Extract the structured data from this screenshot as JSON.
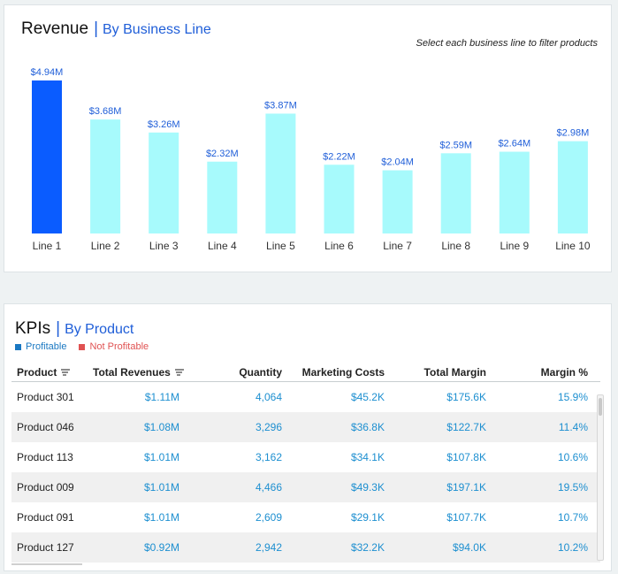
{
  "revenue": {
    "title": "Revenue",
    "separator": "|",
    "subtitle": "By Business Line",
    "hint": "Select each business line to filter products"
  },
  "chart_data": {
    "type": "bar",
    "categories": [
      "Line 1",
      "Line 2",
      "Line 3",
      "Line 4",
      "Line 5",
      "Line 6",
      "Line 7",
      "Line 8",
      "Line 9",
      "Line 10"
    ],
    "values": [
      4.94,
      3.68,
      3.26,
      2.32,
      3.87,
      2.22,
      2.04,
      2.59,
      2.64,
      2.98
    ],
    "data_labels": [
      "$4.94M",
      "$3.68M",
      "$3.26M",
      "$2.32M",
      "$3.87M",
      "$2.22M",
      "$2.04M",
      "$2.59M",
      "$2.64M",
      "$2.98M"
    ],
    "unit": "$M",
    "ylim": [
      0,
      4.94
    ],
    "selected_index": 0,
    "colors": {
      "selected": "#0a5cff",
      "default": "#a7fafc",
      "label": "#1f5ed8"
    },
    "grid": false
  },
  "kpis": {
    "title": "KPIs",
    "separator": "|",
    "subtitle": "By Product",
    "legend": [
      {
        "label": "Profitable",
        "color": "#1a78c2"
      },
      {
        "label": "Not Profitable",
        "color": "#e05252"
      }
    ],
    "columns": [
      "Product",
      "Total Revenues",
      "Quantity",
      "Marketing Costs",
      "Total Margin",
      "Margin %"
    ],
    "rows": [
      [
        "Product 301",
        "$1.11M",
        "4,064",
        "$45.2K",
        "$175.6K",
        "15.9%"
      ],
      [
        "Product 046",
        "$1.08M",
        "3,296",
        "$36.8K",
        "$122.7K",
        "11.4%"
      ],
      [
        "Product 113",
        "$1.01M",
        "3,162",
        "$34.1K",
        "$107.8K",
        "10.6%"
      ],
      [
        "Product 009",
        "$1.01M",
        "4,466",
        "$49.3K",
        "$197.1K",
        "19.5%"
      ],
      [
        "Product 091",
        "$1.01M",
        "2,609",
        "$29.1K",
        "$107.7K",
        "10.7%"
      ],
      [
        "Product 127",
        "$0.92M",
        "2,942",
        "$32.2K",
        "$94.0K",
        "10.2%"
      ]
    ],
    "sort_icon": "sort-icon"
  }
}
